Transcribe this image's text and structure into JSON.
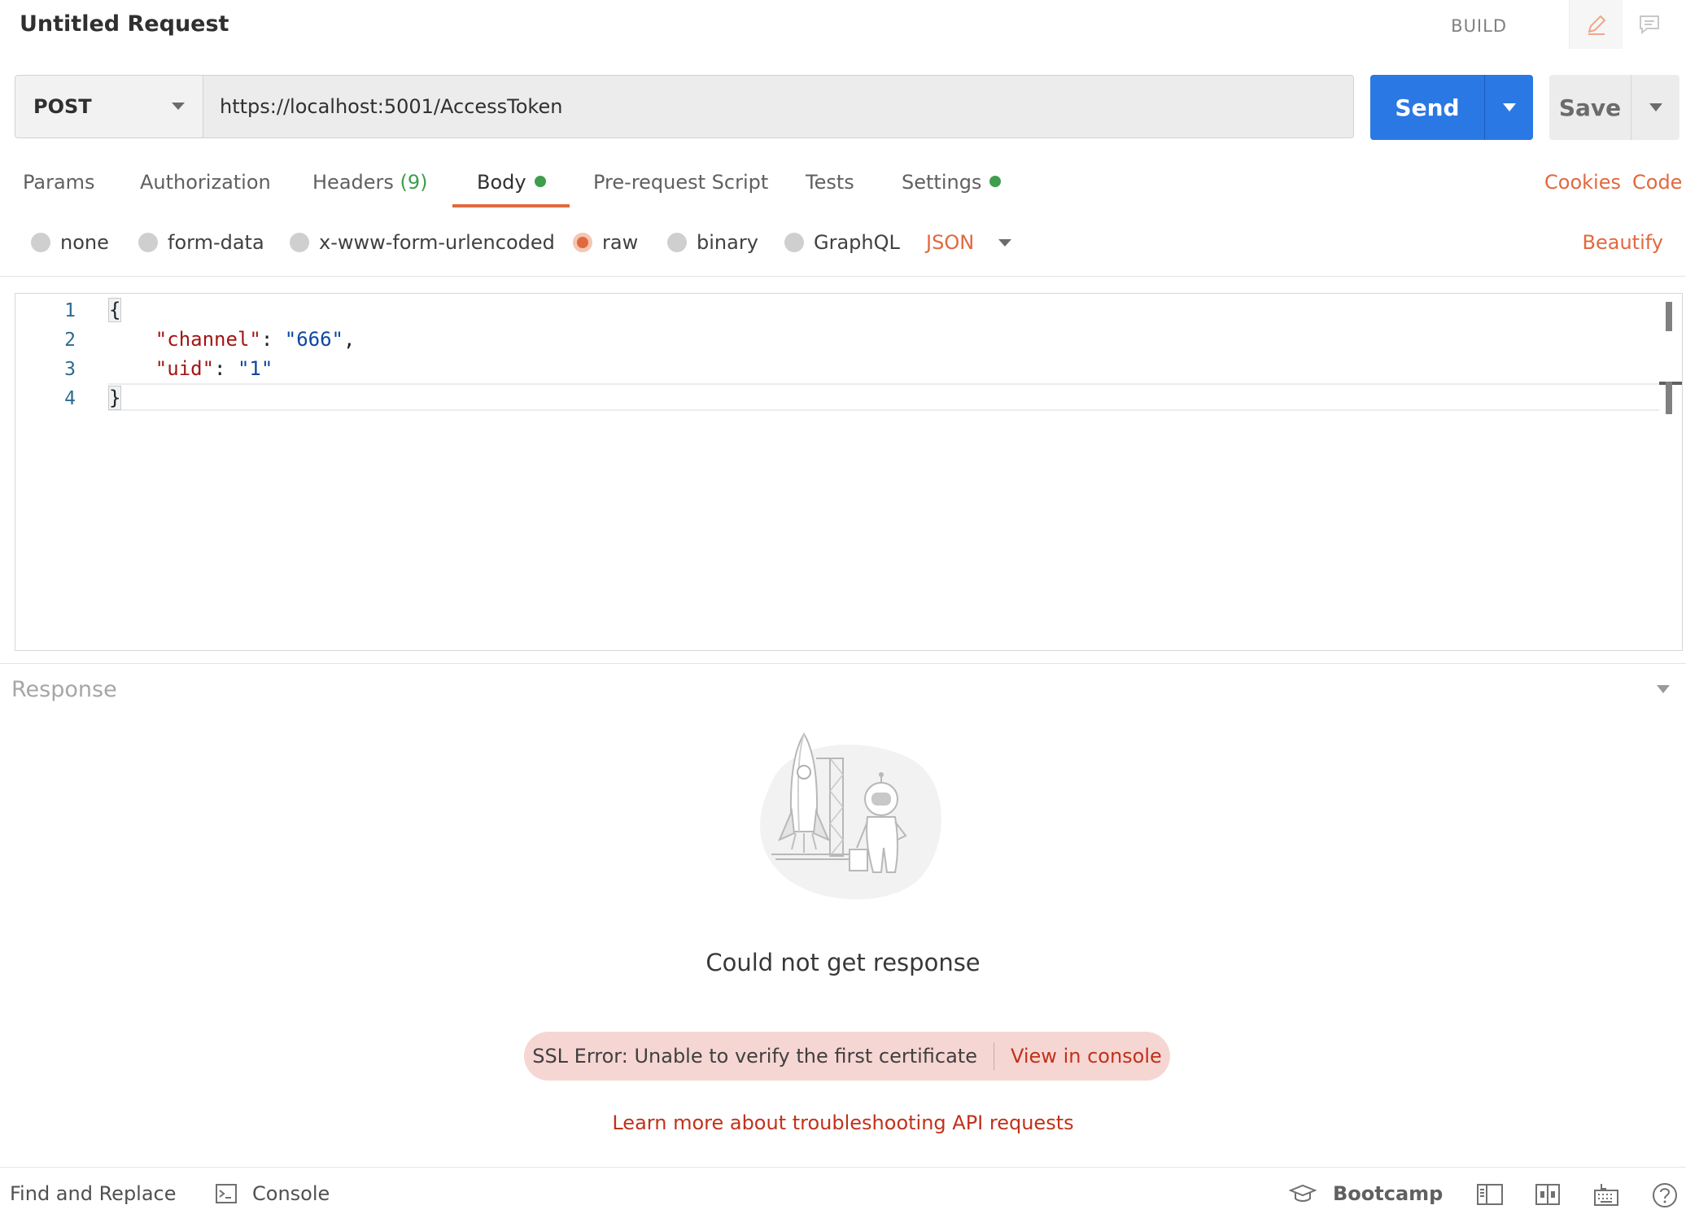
{
  "header": {
    "title": "Untitled Request",
    "mode": "BUILD",
    "edit_icon": "pencil-icon",
    "comment_icon": "comment-icon"
  },
  "request": {
    "method": "POST",
    "url": "https://localhost:5001/AccessToken",
    "send_label": "Send",
    "save_label": "Save"
  },
  "tabs": {
    "params": "Params",
    "authorization": "Authorization",
    "headers": "Headers",
    "headers_count": "(9)",
    "body": "Body",
    "prerequest": "Pre-request Script",
    "tests": "Tests",
    "settings": "Settings",
    "cookies": "Cookies",
    "code": "Code"
  },
  "body_types": {
    "none": "none",
    "form_data": "form-data",
    "urlencoded": "x-www-form-urlencoded",
    "raw": "raw",
    "binary": "binary",
    "graphql": "GraphQL",
    "format": "JSON",
    "beautify": "Beautify",
    "selected": "raw"
  },
  "editor": {
    "line_numbers": [
      "1",
      "2",
      "3",
      "4"
    ],
    "open_brace": "{",
    "close_brace": "}",
    "key_channel": "\"channel\"",
    "val_channel": "\"666\"",
    "key_uid": "\"uid\"",
    "val_uid": "\"1\""
  },
  "response": {
    "label": "Response",
    "message": "Could not get response",
    "error": "SSL Error: Unable to verify the first certificate",
    "view_console": "View in console",
    "learn_more": "Learn more about troubleshooting API requests"
  },
  "footer": {
    "find_replace": "Find and Replace",
    "console": "Console",
    "bootcamp": "Bootcamp"
  },
  "colors": {
    "accent": "#e2683e",
    "primary": "#2a78e4",
    "success": "#3e9e4d",
    "error": "#c0321a"
  }
}
